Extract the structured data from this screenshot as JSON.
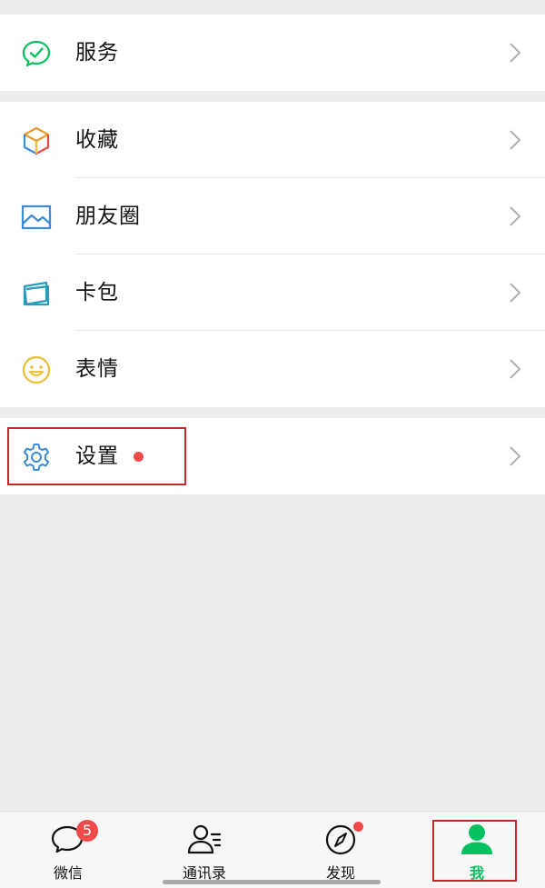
{
  "menu": {
    "services": {
      "label": "服务"
    },
    "favorites": {
      "label": "收藏"
    },
    "moments": {
      "label": "朋友圈"
    },
    "cards": {
      "label": "卡包"
    },
    "stickers": {
      "label": "表情"
    },
    "settings": {
      "label": "设置",
      "has_new_dot": true
    }
  },
  "tabbar": {
    "chats": {
      "label": "微信",
      "badge": "5"
    },
    "contacts": {
      "label": "通讯录"
    },
    "discover": {
      "label": "发现",
      "has_new_dot": true
    },
    "me": {
      "label": "我",
      "active": true
    }
  },
  "colors": {
    "accent_green": "#07c160",
    "badge_red": "#f04a4a",
    "highlight_red": "#c8262c",
    "background": "#ededed"
  }
}
